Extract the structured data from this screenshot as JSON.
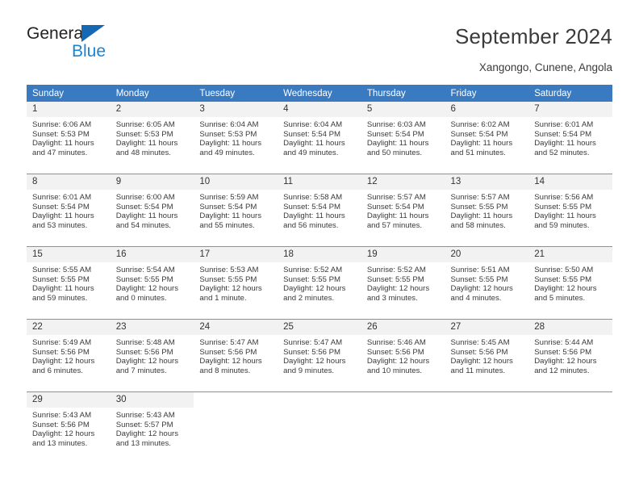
{
  "brand": {
    "name_part1": "General",
    "name_part2": "Blue",
    "icon": "triangle-logo-icon"
  },
  "header": {
    "title": "September 2024",
    "subtitle": "Xangongo, Cunene, Angola"
  },
  "calendar": {
    "weekdays": [
      "Sunday",
      "Monday",
      "Tuesday",
      "Wednesday",
      "Thursday",
      "Friday",
      "Saturday"
    ],
    "accent_color": "#3a7ac0",
    "daynum_bg": "#f2f2f2",
    "row_separator_color": "#6699cc",
    "weeks": [
      [
        {
          "day": "1",
          "sunrise": "Sunrise: 6:06 AM",
          "sunset": "Sunset: 5:53 PM",
          "daylight_line1": "Daylight: 11 hours",
          "daylight_line2": "and 47 minutes."
        },
        {
          "day": "2",
          "sunrise": "Sunrise: 6:05 AM",
          "sunset": "Sunset: 5:53 PM",
          "daylight_line1": "Daylight: 11 hours",
          "daylight_line2": "and 48 minutes."
        },
        {
          "day": "3",
          "sunrise": "Sunrise: 6:04 AM",
          "sunset": "Sunset: 5:53 PM",
          "daylight_line1": "Daylight: 11 hours",
          "daylight_line2": "and 49 minutes."
        },
        {
          "day": "4",
          "sunrise": "Sunrise: 6:04 AM",
          "sunset": "Sunset: 5:54 PM",
          "daylight_line1": "Daylight: 11 hours",
          "daylight_line2": "and 49 minutes."
        },
        {
          "day": "5",
          "sunrise": "Sunrise: 6:03 AM",
          "sunset": "Sunset: 5:54 PM",
          "daylight_line1": "Daylight: 11 hours",
          "daylight_line2": "and 50 minutes."
        },
        {
          "day": "6",
          "sunrise": "Sunrise: 6:02 AM",
          "sunset": "Sunset: 5:54 PM",
          "daylight_line1": "Daylight: 11 hours",
          "daylight_line2": "and 51 minutes."
        },
        {
          "day": "7",
          "sunrise": "Sunrise: 6:01 AM",
          "sunset": "Sunset: 5:54 PM",
          "daylight_line1": "Daylight: 11 hours",
          "daylight_line2": "and 52 minutes."
        }
      ],
      [
        {
          "day": "8",
          "sunrise": "Sunrise: 6:01 AM",
          "sunset": "Sunset: 5:54 PM",
          "daylight_line1": "Daylight: 11 hours",
          "daylight_line2": "and 53 minutes."
        },
        {
          "day": "9",
          "sunrise": "Sunrise: 6:00 AM",
          "sunset": "Sunset: 5:54 PM",
          "daylight_line1": "Daylight: 11 hours",
          "daylight_line2": "and 54 minutes."
        },
        {
          "day": "10",
          "sunrise": "Sunrise: 5:59 AM",
          "sunset": "Sunset: 5:54 PM",
          "daylight_line1": "Daylight: 11 hours",
          "daylight_line2": "and 55 minutes."
        },
        {
          "day": "11",
          "sunrise": "Sunrise: 5:58 AM",
          "sunset": "Sunset: 5:54 PM",
          "daylight_line1": "Daylight: 11 hours",
          "daylight_line2": "and 56 minutes."
        },
        {
          "day": "12",
          "sunrise": "Sunrise: 5:57 AM",
          "sunset": "Sunset: 5:54 PM",
          "daylight_line1": "Daylight: 11 hours",
          "daylight_line2": "and 57 minutes."
        },
        {
          "day": "13",
          "sunrise": "Sunrise: 5:57 AM",
          "sunset": "Sunset: 5:55 PM",
          "daylight_line1": "Daylight: 11 hours",
          "daylight_line2": "and 58 minutes."
        },
        {
          "day": "14",
          "sunrise": "Sunrise: 5:56 AM",
          "sunset": "Sunset: 5:55 PM",
          "daylight_line1": "Daylight: 11 hours",
          "daylight_line2": "and 59 minutes."
        }
      ],
      [
        {
          "day": "15",
          "sunrise": "Sunrise: 5:55 AM",
          "sunset": "Sunset: 5:55 PM",
          "daylight_line1": "Daylight: 11 hours",
          "daylight_line2": "and 59 minutes."
        },
        {
          "day": "16",
          "sunrise": "Sunrise: 5:54 AM",
          "sunset": "Sunset: 5:55 PM",
          "daylight_line1": "Daylight: 12 hours",
          "daylight_line2": "and 0 minutes."
        },
        {
          "day": "17",
          "sunrise": "Sunrise: 5:53 AM",
          "sunset": "Sunset: 5:55 PM",
          "daylight_line1": "Daylight: 12 hours",
          "daylight_line2": "and 1 minute."
        },
        {
          "day": "18",
          "sunrise": "Sunrise: 5:52 AM",
          "sunset": "Sunset: 5:55 PM",
          "daylight_line1": "Daylight: 12 hours",
          "daylight_line2": "and 2 minutes."
        },
        {
          "day": "19",
          "sunrise": "Sunrise: 5:52 AM",
          "sunset": "Sunset: 5:55 PM",
          "daylight_line1": "Daylight: 12 hours",
          "daylight_line2": "and 3 minutes."
        },
        {
          "day": "20",
          "sunrise": "Sunrise: 5:51 AM",
          "sunset": "Sunset: 5:55 PM",
          "daylight_line1": "Daylight: 12 hours",
          "daylight_line2": "and 4 minutes."
        },
        {
          "day": "21",
          "sunrise": "Sunrise: 5:50 AM",
          "sunset": "Sunset: 5:55 PM",
          "daylight_line1": "Daylight: 12 hours",
          "daylight_line2": "and 5 minutes."
        }
      ],
      [
        {
          "day": "22",
          "sunrise": "Sunrise: 5:49 AM",
          "sunset": "Sunset: 5:56 PM",
          "daylight_line1": "Daylight: 12 hours",
          "daylight_line2": "and 6 minutes."
        },
        {
          "day": "23",
          "sunrise": "Sunrise: 5:48 AM",
          "sunset": "Sunset: 5:56 PM",
          "daylight_line1": "Daylight: 12 hours",
          "daylight_line2": "and 7 minutes."
        },
        {
          "day": "24",
          "sunrise": "Sunrise: 5:47 AM",
          "sunset": "Sunset: 5:56 PM",
          "daylight_line1": "Daylight: 12 hours",
          "daylight_line2": "and 8 minutes."
        },
        {
          "day": "25",
          "sunrise": "Sunrise: 5:47 AM",
          "sunset": "Sunset: 5:56 PM",
          "daylight_line1": "Daylight: 12 hours",
          "daylight_line2": "and 9 minutes."
        },
        {
          "day": "26",
          "sunrise": "Sunrise: 5:46 AM",
          "sunset": "Sunset: 5:56 PM",
          "daylight_line1": "Daylight: 12 hours",
          "daylight_line2": "and 10 minutes."
        },
        {
          "day": "27",
          "sunrise": "Sunrise: 5:45 AM",
          "sunset": "Sunset: 5:56 PM",
          "daylight_line1": "Daylight: 12 hours",
          "daylight_line2": "and 11 minutes."
        },
        {
          "day": "28",
          "sunrise": "Sunrise: 5:44 AM",
          "sunset": "Sunset: 5:56 PM",
          "daylight_line1": "Daylight: 12 hours",
          "daylight_line2": "and 12 minutes."
        }
      ],
      [
        {
          "day": "29",
          "sunrise": "Sunrise: 5:43 AM",
          "sunset": "Sunset: 5:56 PM",
          "daylight_line1": "Daylight: 12 hours",
          "daylight_line2": "and 13 minutes."
        },
        {
          "day": "30",
          "sunrise": "Sunrise: 5:43 AM",
          "sunset": "Sunset: 5:57 PM",
          "daylight_line1": "Daylight: 12 hours",
          "daylight_line2": "and 13 minutes."
        },
        {
          "day": "",
          "sunrise": "",
          "sunset": "",
          "daylight_line1": "",
          "daylight_line2": ""
        },
        {
          "day": "",
          "sunrise": "",
          "sunset": "",
          "daylight_line1": "",
          "daylight_line2": ""
        },
        {
          "day": "",
          "sunrise": "",
          "sunset": "",
          "daylight_line1": "",
          "daylight_line2": ""
        },
        {
          "day": "",
          "sunrise": "",
          "sunset": "",
          "daylight_line1": "",
          "daylight_line2": ""
        },
        {
          "day": "",
          "sunrise": "",
          "sunset": "",
          "daylight_line1": "",
          "daylight_line2": ""
        }
      ]
    ]
  }
}
